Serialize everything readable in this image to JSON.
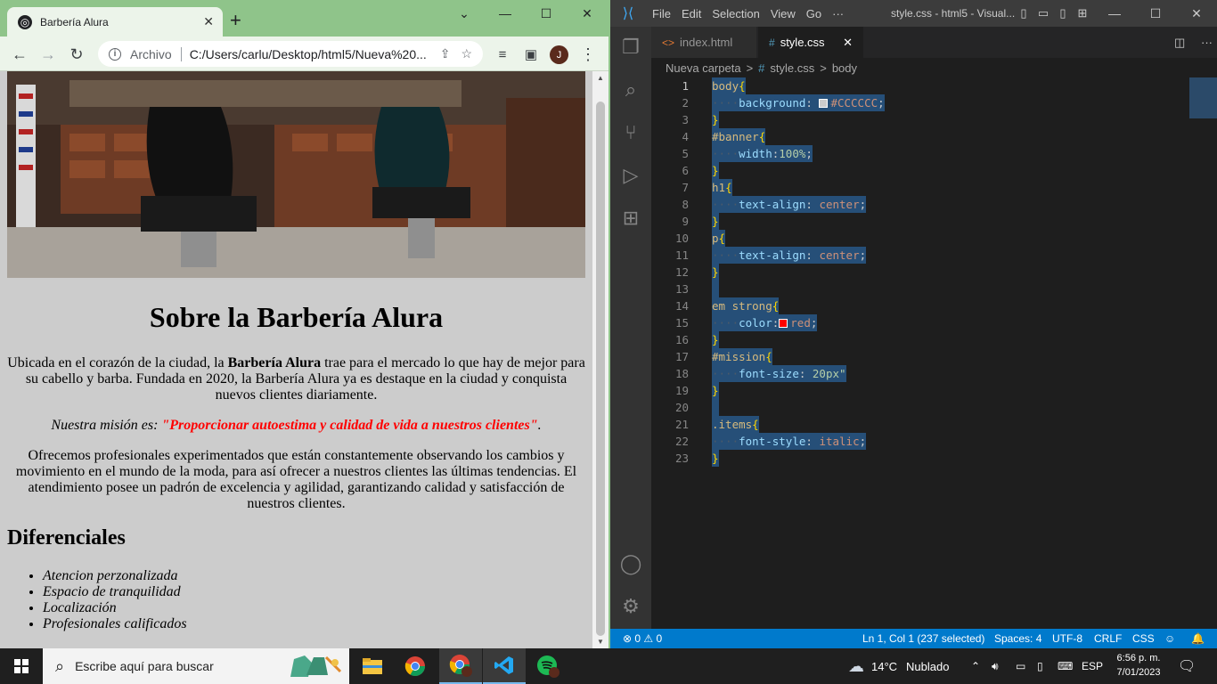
{
  "chrome": {
    "tab_title": "Barbería Alura",
    "tab_close": "✕",
    "new_tab": "+",
    "win_minimize": "⌄",
    "win_min": "—",
    "win_max": "☐",
    "win_close": "✕",
    "back": "←",
    "forward": "→",
    "reload": "↻",
    "info": "i",
    "scheme": "Archivo",
    "url": "C:/Users/carlu/Desktop/html5/Nueva%20...",
    "avatar": "J"
  },
  "page": {
    "heading": "Sobre la Barbería Alura",
    "p1_a": "Ubicada en el corazón de la ciudad, la ",
    "p1_strong": "Barbería Alura",
    "p1_b": " trae para el mercado lo que hay de mejor para su cabello y barba. Fundada en 2020, la Barbería Alura ya es destaque en la ciudad y conquista nuevos clientes diariamente.",
    "mission_label": "Nuestra misión es: ",
    "mission_text": "\"Proporcionar autoestima y calidad de vida a nuestros clientes\"",
    "mission_end": ".",
    "p3": "Ofrecemos profesionales experimentados que están constantemente observando los cambios y movimiento en el mundo de la moda, para así ofrecer a nuestros clientes las últimas tendencias. El atendimiento posee un padrón de excelencia y agilidad, garantizando calidad y satisfacción de nuestros clientes.",
    "h2": "Diferenciales",
    "items": [
      "Atencion perzonalizada",
      "Espacio de tranquilidad",
      "Localización",
      "Profesionales calificados"
    ]
  },
  "vscode": {
    "menu": [
      "File",
      "Edit",
      "Selection",
      "View",
      "Go",
      "···"
    ],
    "window_title": "style.css - html5 - Visual...",
    "tabs": [
      {
        "label": "index.html",
        "icon": "<>"
      },
      {
        "label": "style.css",
        "icon": "#"
      }
    ],
    "tab_close": "✕",
    "breadcrumb": [
      "Nueva carpeta",
      ">",
      "#",
      "style.css",
      ">",
      "body"
    ],
    "status": {
      "problems": "⊗ 0 ⚠ 0",
      "position": "Ln 1, Col 1 (237 selected)",
      "spaces": "Spaces: 4",
      "encoding": "UTF-8",
      "eol": "CRLF",
      "language": "CSS"
    },
    "line_numbers": [
      "1",
      "2",
      "3",
      "4",
      "5",
      "6",
      "7",
      "8",
      "9",
      "10",
      "11",
      "12",
      "13",
      "14",
      "15",
      "16",
      "17",
      "18",
      "19",
      "20",
      "21",
      "22",
      "23"
    ],
    "code": {
      "l1": "body",
      "l2p": "background",
      "l2v": "#CCCCCC",
      "l2c": "#CCCCCC",
      "l4": "#banner",
      "l5p": "width",
      "l5v": "100%",
      "l7": "h1",
      "l8p": "text-align",
      "l8v": "center",
      "l10": "p",
      "l11p": "text-align",
      "l11v": "center",
      "l14": "em strong",
      "l15p": "color",
      "l15v": "red",
      "l15c": "#ff0000",
      "l17": "#mission",
      "l18p": "font-size",
      "l18v": "20px\"",
      "l21": ".items",
      "l22p": "font-style",
      "l22v": "italic"
    }
  },
  "taskbar": {
    "search_placeholder": "Escribe aquí para buscar",
    "temperature": "14°C",
    "weather": "Nublado",
    "language": "ESP",
    "time": "6:56 p. m.",
    "date": "7/01/2023"
  }
}
